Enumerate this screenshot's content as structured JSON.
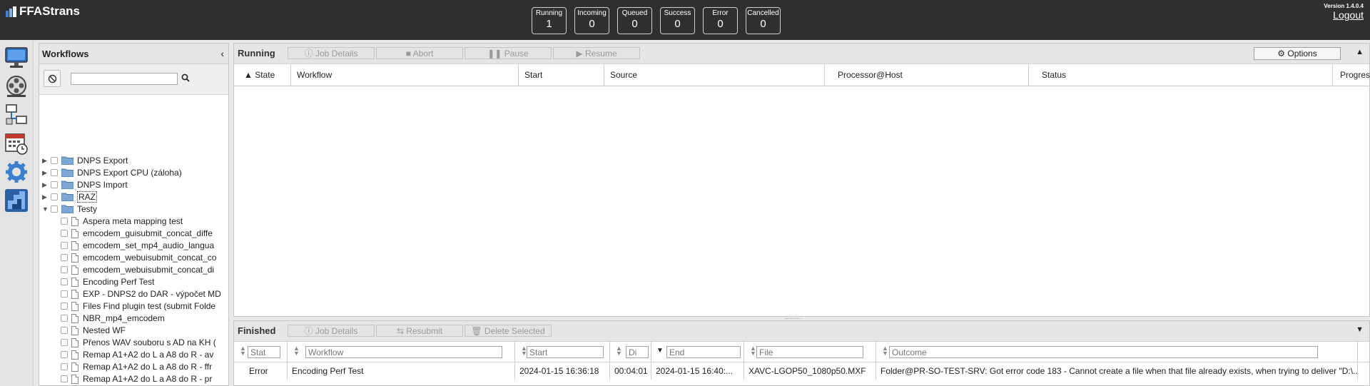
{
  "app": {
    "title": "FFAStrans",
    "version": "Version 1.4.0.4",
    "logout": "Logout"
  },
  "status": [
    {
      "label": "Running",
      "value": "1"
    },
    {
      "label": "Incoming",
      "value": "0"
    },
    {
      "label": "Queued",
      "value": "0"
    },
    {
      "label": "Success",
      "value": "0"
    },
    {
      "label": "Error",
      "value": "0"
    },
    {
      "label": "Cancelled",
      "value": "0"
    }
  ],
  "workflows": {
    "title": "Workflows",
    "search_value": "",
    "folders": [
      "DNPS Export",
      "DNPS Export CPU (záloha)",
      "DNPS Import",
      "RAZ",
      "Testy"
    ],
    "items": [
      "Aspera meta mapping test",
      "emcodem_guisubmit_concat_diffe",
      "emcodem_set_mp4_audio_langua",
      "emcodem_webuisubmit_concat_co",
      "emcodem_webuisubmit_concat_di",
      "Encoding Perf Test",
      "EXP - DNPS2 do DAR - výpočet MD",
      "Files Find plugin test (submit Folde",
      "NBR_mp4_emcodem",
      "Nested WF",
      "Přenos WAV souboru s AD na KH (",
      "Remap A1+A2 do L a A8 do R - av",
      "Remap A1+A2 do L a A8 do R - ffr",
      "Remap A1+A2 do L a A8 do R - pr"
    ]
  },
  "running": {
    "title": "Running",
    "buttons": {
      "details": "Job Details",
      "abort": "Abort",
      "pause": "Pause",
      "resume": "Resume",
      "options": "Options"
    },
    "columns": [
      "State",
      "Workflow",
      "Start",
      "Source",
      "Processor@Host",
      "Status",
      "Progres"
    ]
  },
  "finished": {
    "title": "Finished",
    "buttons": {
      "details": "Job Details",
      "resubmit": "Resubmit",
      "delete": "Delete Selected"
    },
    "filters": [
      "Stat",
      "Workflow",
      "Start",
      "Di",
      "End",
      "File",
      "Outcome"
    ],
    "row": {
      "state": "Error",
      "workflow": "Encoding Perf Test",
      "start": "2024-01-15 16:36:18",
      "duration": "00:04:01",
      "end": "2024-01-15 16:40:...",
      "file": "XAVC-LGOP50_1080p50.MXF",
      "outcome": "Folder@PR-SO-TEST-SRV: Got error code 183 - Cannot create a file when that file already exists, when trying to deliver \"D:\\..."
    }
  },
  "colors": {
    "header_bg": "#2f2f2f",
    "accent_blue": "#3a7fd0"
  }
}
